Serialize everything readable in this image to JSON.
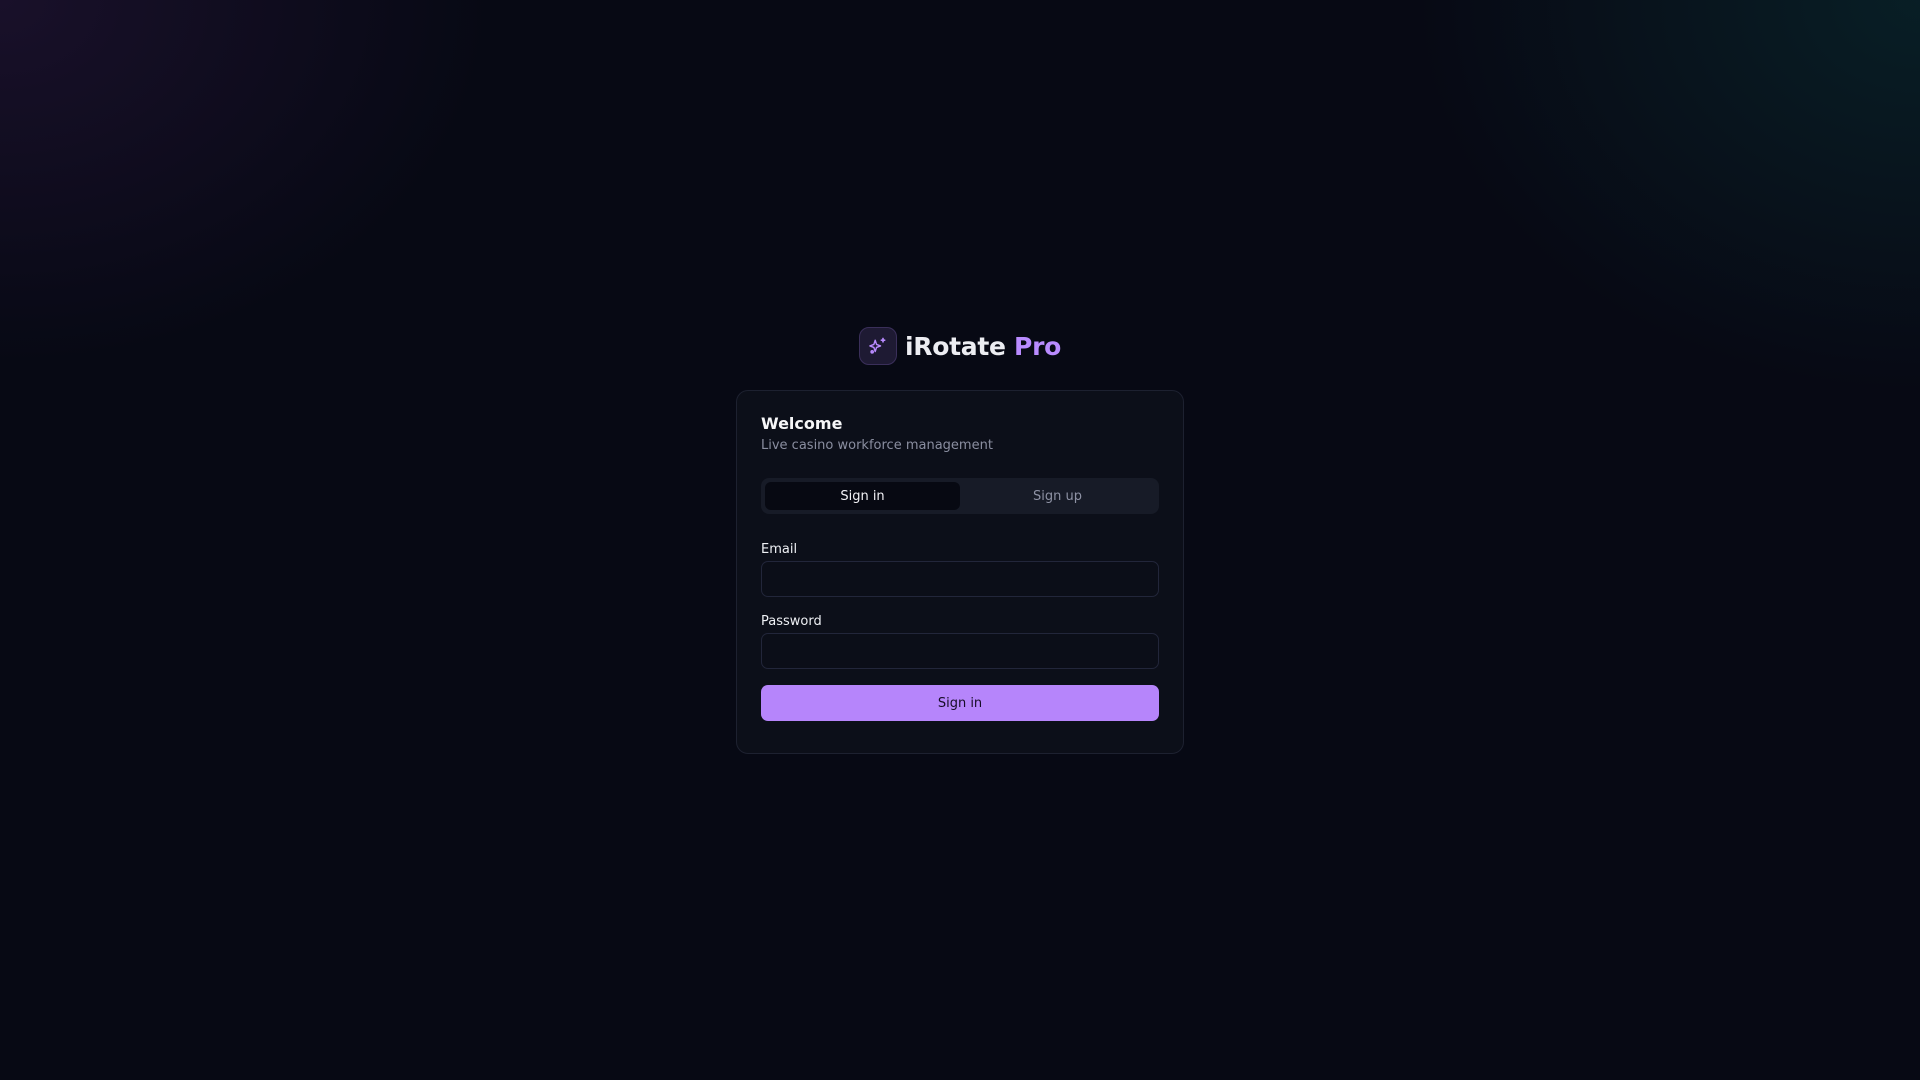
{
  "brand": {
    "name_main": "iRotate",
    "name_accent": "Pro",
    "logo_icon": "sparkles-icon",
    "accent_color": "#b98bff"
  },
  "card": {
    "title": "Welcome",
    "subtitle": "Live casino workforce management"
  },
  "tabs": [
    {
      "label": "Sign in",
      "active": true
    },
    {
      "label": "Sign up",
      "active": false
    }
  ],
  "form": {
    "email_label": "Email",
    "email_value": "",
    "email_placeholder": "",
    "password_label": "Password",
    "password_value": "",
    "password_placeholder": "",
    "submit_label": "Sign in",
    "submit_color": "#b685fb"
  }
}
